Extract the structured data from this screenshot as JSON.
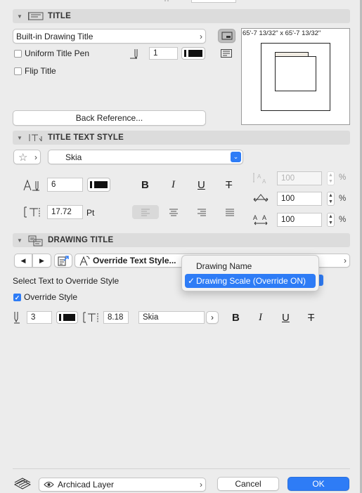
{
  "title_section": {
    "header": "TITLE",
    "title_type": "Built-in Drawing Title",
    "uniform_title_pen": "Uniform Title Pen",
    "pen_value": "1",
    "flip_title": "Flip Title",
    "back_reference": "Back Reference...",
    "preview_dims": "65'-7 13/32\" x 65'-7 13/32\""
  },
  "title_text_style": {
    "header": "TITLE TEXT STYLE",
    "font": "Skia",
    "pen": "6",
    "size": "17.72",
    "unit": "Pt",
    "width_factor": "100",
    "char_spacing": "100",
    "slant": "100",
    "percent": "%"
  },
  "drawing_title": {
    "header": "DRAWING TITLE",
    "override_button": "Override Text Style...",
    "select_text_label": "Select Text to Override Style",
    "override_style": "Override Style",
    "pen": "3",
    "size": "8.18",
    "font": "Skia"
  },
  "dropdown": {
    "items": [
      "Drawing Name",
      "Drawing Scale (Override ON)"
    ],
    "checkmark": "✓"
  },
  "footer": {
    "layer": "Archicad Layer",
    "cancel": "Cancel",
    "ok": "OK"
  },
  "format": {
    "bold": "B",
    "italic": "I",
    "underline": "U",
    "strike": "T"
  },
  "colors": {
    "accent": "#2e7cf6",
    "header_bg": "#dcdcdc",
    "panel_bg": "#ececec"
  }
}
